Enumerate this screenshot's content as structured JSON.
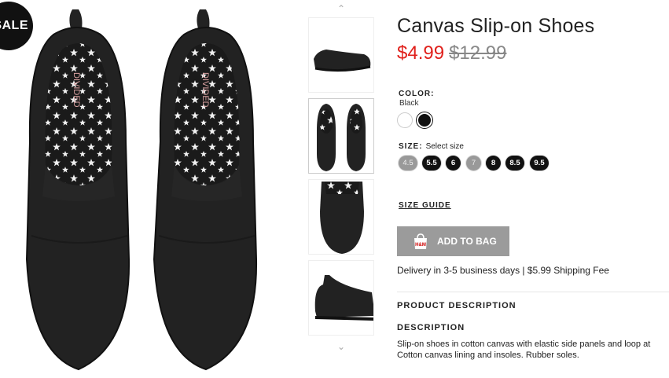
{
  "badge": {
    "sale": "SALE"
  },
  "product": {
    "title": "Canvas Slip-on Shoes",
    "price_sale": "$4.99",
    "price_old": "$12.99"
  },
  "color": {
    "label": "COLOR:",
    "selected": "Black",
    "swatches": [
      {
        "name": "White",
        "hex": "#ffffff"
      },
      {
        "name": "Black",
        "hex": "#111111"
      }
    ]
  },
  "size": {
    "label": "SIZE:",
    "hint": "Select size",
    "options": [
      {
        "label": "4.5",
        "available": false
      },
      {
        "label": "5.5",
        "available": true
      },
      {
        "label": "6",
        "available": true
      },
      {
        "label": "7",
        "available": false
      },
      {
        "label": "8",
        "available": true
      },
      {
        "label": "8.5",
        "available": true
      },
      {
        "label": "9.5",
        "available": true
      }
    ]
  },
  "size_guide": "SIZE GUIDE",
  "add_to_bag": {
    "label": "ADD TO BAG",
    "brand": "H&M"
  },
  "delivery": "Delivery in 3-5 business days | $5.99 Shipping Fee",
  "product_description_heading": "PRODUCT DESCRIPTION",
  "description_heading": "DESCRIPTION",
  "description_lines": [
    "Slip-on shoes in cotton canvas with elastic side panels and loop at",
    "Cotton canvas lining and insoles. Rubber soles."
  ],
  "insole_brand": "DIVIDED",
  "colors": {
    "sale_price": "#e0201b",
    "button_bg": "#9b9b9b"
  }
}
